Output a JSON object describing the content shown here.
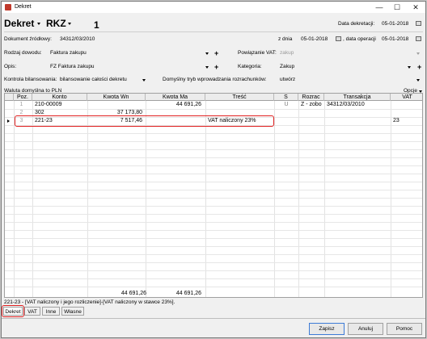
{
  "window": {
    "title": "Dekret",
    "minimize_icon": "minimize-icon",
    "maximize_icon": "maximize-icon",
    "close_icon": "close-icon"
  },
  "header": {
    "doc_type": "Dekret",
    "register": "RKZ",
    "number": "1",
    "decree_date_label": "Data dekretacji:",
    "decree_date": "05-01-2018"
  },
  "source": {
    "label": "Dokument źródłowy:",
    "value": "34312/03/2010",
    "from_date_label": "z dnia",
    "from_date": "05-01-2018",
    "op_date_label": ", data operacji",
    "op_date": "05-01-2018"
  },
  "evidence": {
    "label": "Rodzaj dowodu:",
    "value": "Faktura zakupu",
    "vat_link_label": "Powiązanie VAT:",
    "vat_link_value": "zakup"
  },
  "description": {
    "label": "Opis:",
    "value": "FZ Faktura zakupu",
    "category_label": "Kategoria:",
    "category_value": "Zakup"
  },
  "balance": {
    "label": "Kontrola bilansowania:",
    "value": "bilansowanie całości dekretu",
    "mode_label": "Domyślny tryb wprowadzania rozrachunków:",
    "mode_value": "utwórz"
  },
  "currency_link": "Waluta domyślna to PLN",
  "options_label": "Opcje",
  "grid": {
    "columns": [
      "Poz.",
      "Konto",
      "Kwota Wn",
      "Kwota Ma",
      "Treść",
      "S",
      "Rozrac",
      "Transakcja",
      "VAT"
    ],
    "rows": [
      {
        "poz": "1",
        "konto": "210-00009",
        "wn": "",
        "ma": "44 691,26",
        "tresc": "",
        "s": "U",
        "rozrac": "Z - zobo",
        "trans": "34312/03/2010",
        "vat": ""
      },
      {
        "poz": "2",
        "konto": "302",
        "wn": "37 173,80",
        "ma": "",
        "tresc": "",
        "s": "",
        "rozrac": "",
        "trans": "",
        "vat": ""
      },
      {
        "poz": "3",
        "konto": "221-23",
        "wn": "7 517,46",
        "ma": "",
        "tresc": "VAT naliczony 23%",
        "s": "",
        "rozrac": "",
        "trans": "",
        "vat": "23"
      }
    ],
    "total_wn": "44 691,26",
    "total_ma": "44 691,26"
  },
  "status_text": "221-23 - [VAT naliczony i jego rozliczenie]-[VAT naliczony w stawce 23%].",
  "tabs": [
    "Dekret",
    "VAT",
    "Inne",
    "Własne"
  ],
  "buttons": {
    "save": "Zapisz",
    "cancel": "Anuluj",
    "help": "Pomoc"
  },
  "colors": {
    "highlight": "#e02020",
    "grid_border": "#a0a0a0"
  }
}
